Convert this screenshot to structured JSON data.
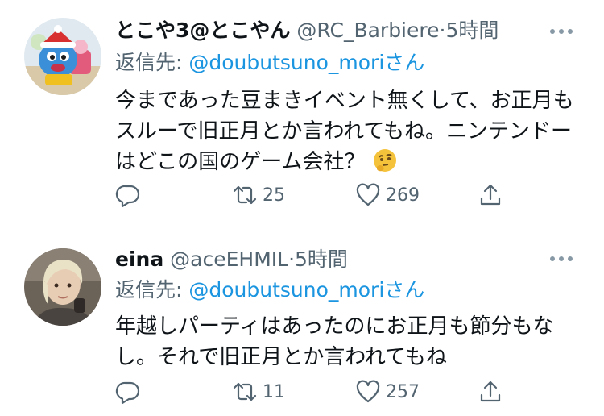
{
  "tweets": [
    {
      "name": "とこや3@とこやん",
      "handle": "@RC_Barbiere",
      "separator": "·",
      "time": "5時間",
      "reply_prefix": "返信先: ",
      "reply_mention": "@doubutsuno_mori",
      "reply_suffix": "さん",
      "text": "今まであった豆まきイベント無くして、お正月もスルーで旧正月とか言われてもね。ニンテンドーはどこの国のゲーム会社？",
      "emoji": "thinking-face",
      "replies": "",
      "retweets": "25",
      "likes": "269"
    },
    {
      "name": "eina",
      "handle": "@aceEHMIL",
      "separator": "·",
      "time": "5時間",
      "reply_prefix": "返信先: ",
      "reply_mention": "@doubutsuno_mori",
      "reply_suffix": "さん",
      "text": "年越しパーティはあったのにお正月も節分もなし。それで旧正月とか言われてもね",
      "replies": "",
      "retweets": "11",
      "likes": "257"
    }
  ],
  "colors": {
    "secondary_text": "#536471",
    "link": "#1b95e0",
    "divider": "#e6ecf0"
  },
  "icons": {
    "reply": "speech-bubble-icon",
    "retweet": "retweet-arrows-icon",
    "like": "heart-icon",
    "share": "share-upload-icon",
    "more": "three-dots-icon"
  }
}
